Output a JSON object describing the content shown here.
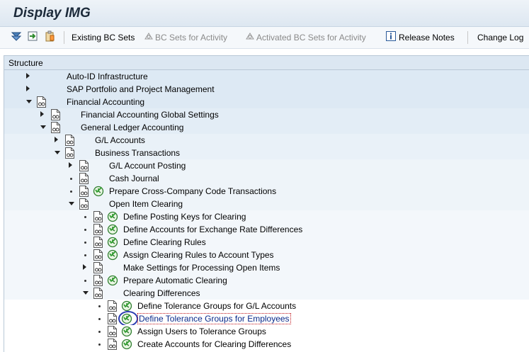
{
  "window": {
    "title": "Display IMG"
  },
  "toolbar": {
    "existing_bc_sets": "Existing BC Sets",
    "bc_sets_for_activity": "BC Sets for Activity",
    "activated_bc_sets": "Activated BC Sets for Activity",
    "release_notes": "Release Notes",
    "change_log": "Change Log"
  },
  "tree": {
    "header": "Structure",
    "rows": [
      {
        "label": "Auto-ID Infrastructure",
        "level": 0,
        "state": "collapsed",
        "doc": false,
        "exec": false
      },
      {
        "label": "SAP Portfolio and Project Management",
        "level": 0,
        "state": "collapsed",
        "doc": false,
        "exec": false
      },
      {
        "label": "Financial Accounting",
        "level": 0,
        "state": "expanded",
        "doc": true,
        "exec": false
      },
      {
        "label": "Financial Accounting Global Settings",
        "level": 1,
        "state": "collapsed",
        "doc": true,
        "exec": false
      },
      {
        "label": "General Ledger Accounting",
        "level": 1,
        "state": "expanded",
        "doc": true,
        "exec": false
      },
      {
        "label": "G/L Accounts",
        "level": 2,
        "state": "collapsed",
        "doc": true,
        "exec": false
      },
      {
        "label": "Business Transactions",
        "level": 2,
        "state": "expanded",
        "doc": true,
        "exec": false
      },
      {
        "label": "G/L Account Posting",
        "level": 3,
        "state": "collapsed",
        "doc": true,
        "exec": false
      },
      {
        "label": "Cash Journal",
        "level": 3,
        "state": "leaf",
        "doc": true,
        "exec": false
      },
      {
        "label": "Prepare Cross-Company Code Transactions",
        "level": 3,
        "state": "leaf",
        "doc": true,
        "exec": true
      },
      {
        "label": "Open Item Clearing",
        "level": 3,
        "state": "expanded",
        "doc": true,
        "exec": false
      },
      {
        "label": "Define Posting Keys for Clearing",
        "level": 4,
        "state": "leaf",
        "doc": true,
        "exec": true
      },
      {
        "label": "Define Accounts for Exchange Rate Differences",
        "level": 4,
        "state": "leaf",
        "doc": true,
        "exec": true
      },
      {
        "label": "Define Clearing Rules",
        "level": 4,
        "state": "leaf",
        "doc": true,
        "exec": true
      },
      {
        "label": "Assign Clearing Rules to Account Types",
        "level": 4,
        "state": "leaf",
        "doc": true,
        "exec": true
      },
      {
        "label": "Make Settings for Processing Open Items",
        "level": 4,
        "state": "collapsed",
        "doc": true,
        "exec": false
      },
      {
        "label": "Prepare Automatic Clearing",
        "level": 4,
        "state": "leaf",
        "doc": true,
        "exec": true
      },
      {
        "label": "Clearing Differences",
        "level": 4,
        "state": "expanded",
        "doc": true,
        "exec": false
      },
      {
        "label": "Define Tolerance Groups for G/L Accounts",
        "level": 5,
        "state": "leaf",
        "doc": true,
        "exec": true
      },
      {
        "label": "Define Tolerance Groups for Employees",
        "level": 5,
        "state": "leaf",
        "doc": true,
        "exec": true,
        "selected": true
      },
      {
        "label": "Assign Users to Tolerance Groups",
        "level": 5,
        "state": "leaf",
        "doc": true,
        "exec": true
      },
      {
        "label": "Create Accounts for Clearing Differences",
        "level": 5,
        "state": "leaf",
        "doc": true,
        "exec": true
      }
    ]
  }
}
